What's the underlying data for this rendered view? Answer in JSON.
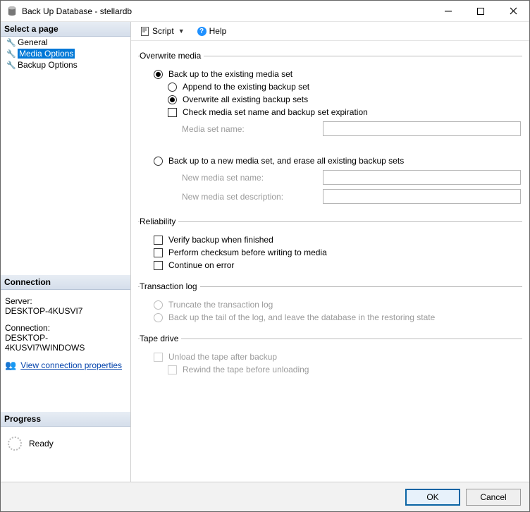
{
  "window": {
    "title": "Back Up Database - stellardb"
  },
  "left": {
    "select_page_hdr": "Select a page",
    "pages": [
      {
        "label": "General"
      },
      {
        "label": "Media Options"
      },
      {
        "label": "Backup Options"
      }
    ],
    "connection_hdr": "Connection",
    "server_label": "Server:",
    "server_value": "DESKTOP-4KUSVI7",
    "connection_label": "Connection:",
    "connection_value": "DESKTOP-4KUSVI7\\WINDOWS",
    "view_conn_props": "View connection properties",
    "progress_hdr": "Progress",
    "progress_text": "Ready"
  },
  "toolbar": {
    "script": "Script",
    "help": "Help"
  },
  "overwrite": {
    "legend": "Overwrite media",
    "back_up_existing": "Back up to the existing media set",
    "append_existing": "Append to the existing backup set",
    "overwrite_all": "Overwrite all existing backup sets",
    "check_media_name": "Check media set name and backup set expiration",
    "media_set_name_label": "Media set name:",
    "back_up_new": "Back up to a new media set, and erase all existing backup sets",
    "new_media_name_label": "New media set name:",
    "new_media_desc_label": "New media set description:"
  },
  "reliability": {
    "legend": "Reliability",
    "verify": "Verify backup when finished",
    "checksum": "Perform checksum before writing to media",
    "continue_err": "Continue on error"
  },
  "txlog": {
    "legend": "Transaction log",
    "truncate": "Truncate the transaction log",
    "tail": "Back up the tail of the log, and leave the database in the restoring state"
  },
  "tape": {
    "legend": "Tape drive",
    "unload": "Unload the tape after backup",
    "rewind": "Rewind the tape before unloading"
  },
  "buttons": {
    "ok": "OK",
    "cancel": "Cancel"
  }
}
